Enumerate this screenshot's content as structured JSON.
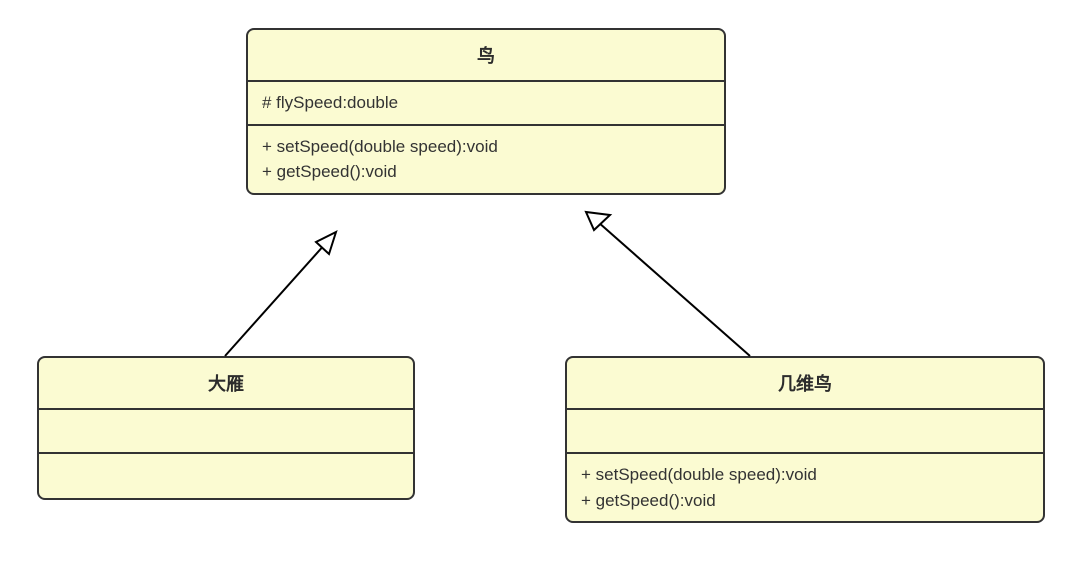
{
  "diagram": {
    "classes": {
      "bird": {
        "name": "鸟",
        "attributes": [
          "# flySpeed:double"
        ],
        "methods": [
          "+ setSpeed(double speed):void",
          "+ getSpeed():void"
        ]
      },
      "wildGoose": {
        "name": "大雁",
        "attributes": [],
        "methods": []
      },
      "kiwi": {
        "name": "几维鸟",
        "attributes": [],
        "methods": [
          "+ setSpeed(double speed):void",
          "+ getSpeed():void"
        ]
      }
    },
    "relations": [
      {
        "from": "wildGoose",
        "to": "bird",
        "type": "generalization"
      },
      {
        "from": "kiwi",
        "to": "bird",
        "type": "generalization"
      }
    ]
  }
}
